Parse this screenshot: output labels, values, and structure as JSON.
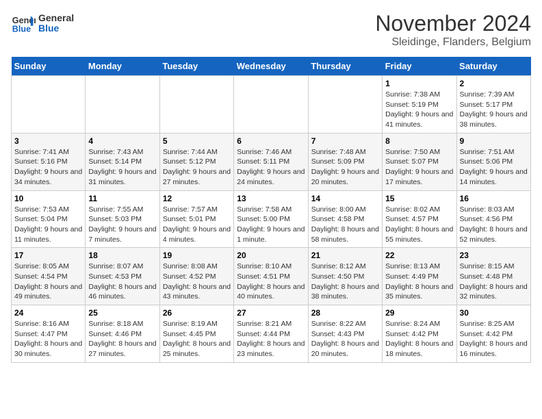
{
  "header": {
    "logo_line1": "General",
    "logo_line2": "Blue",
    "month": "November 2024",
    "location": "Sleidinge, Flanders, Belgium"
  },
  "weekdays": [
    "Sunday",
    "Monday",
    "Tuesday",
    "Wednesday",
    "Thursday",
    "Friday",
    "Saturday"
  ],
  "weeks": [
    [
      {
        "day": "",
        "info": ""
      },
      {
        "day": "",
        "info": ""
      },
      {
        "day": "",
        "info": ""
      },
      {
        "day": "",
        "info": ""
      },
      {
        "day": "",
        "info": ""
      },
      {
        "day": "1",
        "info": "Sunrise: 7:38 AM\nSunset: 5:19 PM\nDaylight: 9 hours and 41 minutes."
      },
      {
        "day": "2",
        "info": "Sunrise: 7:39 AM\nSunset: 5:17 PM\nDaylight: 9 hours and 38 minutes."
      }
    ],
    [
      {
        "day": "3",
        "info": "Sunrise: 7:41 AM\nSunset: 5:16 PM\nDaylight: 9 hours and 34 minutes."
      },
      {
        "day": "4",
        "info": "Sunrise: 7:43 AM\nSunset: 5:14 PM\nDaylight: 9 hours and 31 minutes."
      },
      {
        "day": "5",
        "info": "Sunrise: 7:44 AM\nSunset: 5:12 PM\nDaylight: 9 hours and 27 minutes."
      },
      {
        "day": "6",
        "info": "Sunrise: 7:46 AM\nSunset: 5:11 PM\nDaylight: 9 hours and 24 minutes."
      },
      {
        "day": "7",
        "info": "Sunrise: 7:48 AM\nSunset: 5:09 PM\nDaylight: 9 hours and 20 minutes."
      },
      {
        "day": "8",
        "info": "Sunrise: 7:50 AM\nSunset: 5:07 PM\nDaylight: 9 hours and 17 minutes."
      },
      {
        "day": "9",
        "info": "Sunrise: 7:51 AM\nSunset: 5:06 PM\nDaylight: 9 hours and 14 minutes."
      }
    ],
    [
      {
        "day": "10",
        "info": "Sunrise: 7:53 AM\nSunset: 5:04 PM\nDaylight: 9 hours and 11 minutes."
      },
      {
        "day": "11",
        "info": "Sunrise: 7:55 AM\nSunset: 5:03 PM\nDaylight: 9 hours and 7 minutes."
      },
      {
        "day": "12",
        "info": "Sunrise: 7:57 AM\nSunset: 5:01 PM\nDaylight: 9 hours and 4 minutes."
      },
      {
        "day": "13",
        "info": "Sunrise: 7:58 AM\nSunset: 5:00 PM\nDaylight: 9 hours and 1 minute."
      },
      {
        "day": "14",
        "info": "Sunrise: 8:00 AM\nSunset: 4:58 PM\nDaylight: 8 hours and 58 minutes."
      },
      {
        "day": "15",
        "info": "Sunrise: 8:02 AM\nSunset: 4:57 PM\nDaylight: 8 hours and 55 minutes."
      },
      {
        "day": "16",
        "info": "Sunrise: 8:03 AM\nSunset: 4:56 PM\nDaylight: 8 hours and 52 minutes."
      }
    ],
    [
      {
        "day": "17",
        "info": "Sunrise: 8:05 AM\nSunset: 4:54 PM\nDaylight: 8 hours and 49 minutes."
      },
      {
        "day": "18",
        "info": "Sunrise: 8:07 AM\nSunset: 4:53 PM\nDaylight: 8 hours and 46 minutes."
      },
      {
        "day": "19",
        "info": "Sunrise: 8:08 AM\nSunset: 4:52 PM\nDaylight: 8 hours and 43 minutes."
      },
      {
        "day": "20",
        "info": "Sunrise: 8:10 AM\nSunset: 4:51 PM\nDaylight: 8 hours and 40 minutes."
      },
      {
        "day": "21",
        "info": "Sunrise: 8:12 AM\nSunset: 4:50 PM\nDaylight: 8 hours and 38 minutes."
      },
      {
        "day": "22",
        "info": "Sunrise: 8:13 AM\nSunset: 4:49 PM\nDaylight: 8 hours and 35 minutes."
      },
      {
        "day": "23",
        "info": "Sunrise: 8:15 AM\nSunset: 4:48 PM\nDaylight: 8 hours and 32 minutes."
      }
    ],
    [
      {
        "day": "24",
        "info": "Sunrise: 8:16 AM\nSunset: 4:47 PM\nDaylight: 8 hours and 30 minutes."
      },
      {
        "day": "25",
        "info": "Sunrise: 8:18 AM\nSunset: 4:46 PM\nDaylight: 8 hours and 27 minutes."
      },
      {
        "day": "26",
        "info": "Sunrise: 8:19 AM\nSunset: 4:45 PM\nDaylight: 8 hours and 25 minutes."
      },
      {
        "day": "27",
        "info": "Sunrise: 8:21 AM\nSunset: 4:44 PM\nDaylight: 8 hours and 23 minutes."
      },
      {
        "day": "28",
        "info": "Sunrise: 8:22 AM\nSunset: 4:43 PM\nDaylight: 8 hours and 20 minutes."
      },
      {
        "day": "29",
        "info": "Sunrise: 8:24 AM\nSunset: 4:42 PM\nDaylight: 8 hours and 18 minutes."
      },
      {
        "day": "30",
        "info": "Sunrise: 8:25 AM\nSunset: 4:42 PM\nDaylight: 8 hours and 16 minutes."
      }
    ]
  ]
}
